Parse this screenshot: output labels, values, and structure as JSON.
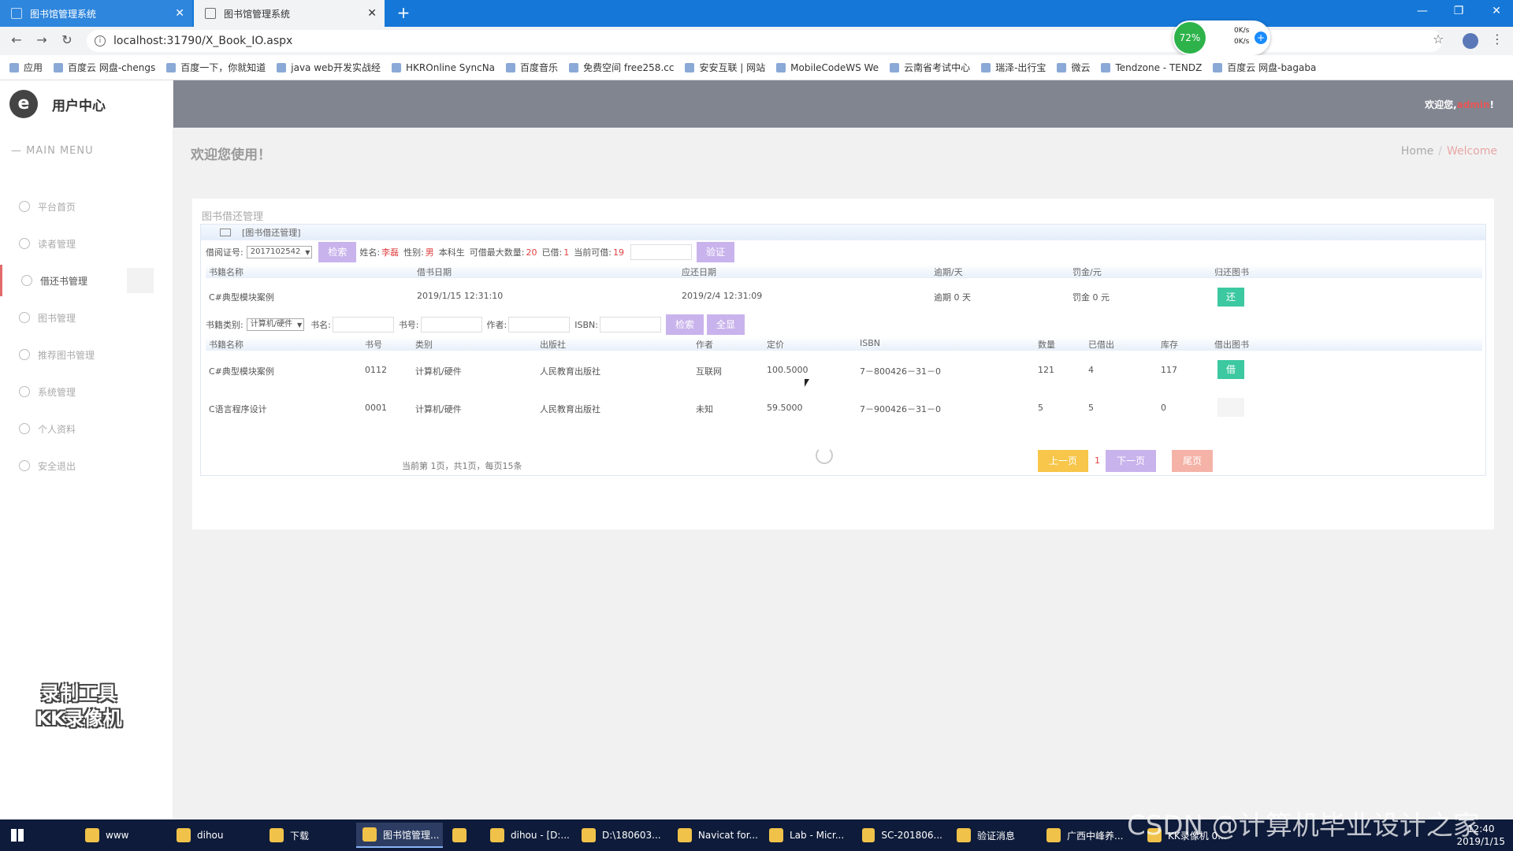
{
  "browser": {
    "tabs": [
      {
        "label": "图书馆管理系统",
        "active": false
      },
      {
        "label": "图书馆管理系统",
        "active": true
      }
    ],
    "url": "localhost:31790/X_Book_IO.aspx",
    "net_widget": {
      "percent": "72%",
      "up": "0K/s",
      "down": "0K/s"
    },
    "bookmarks": [
      "应用",
      "百度云 网盘-chengs",
      "百度一下，你就知道",
      "java web开发实战经",
      "HKROnline SyncNa",
      "百度音乐",
      "免费空间 free258.cc",
      "安安互联 | 网站",
      "MobileCodeWS We",
      "云南省考试中心",
      "瑞泽-出行宝",
      "微云",
      "Tendzone - TENDZ",
      "百度云 网盘-bagaba"
    ]
  },
  "sidebar": {
    "brand": "用户中心",
    "logo": "e",
    "menu_title": "MAIN MENU",
    "items": [
      {
        "label": "平台首页",
        "icon": "eye-icon"
      },
      {
        "label": "读者管理",
        "icon": "reader-icon"
      },
      {
        "label": "借还书管理",
        "icon": "book-borrow-icon",
        "active": true
      },
      {
        "label": "图书管理",
        "icon": "trophy-icon"
      },
      {
        "label": "推荐图书管理",
        "icon": "diamond-icon"
      },
      {
        "label": "系统管理",
        "icon": "monitor-icon"
      },
      {
        "label": "个人资料",
        "icon": "chat-icon"
      },
      {
        "label": "安全退出",
        "icon": "power-icon"
      }
    ],
    "watermark_line1": "录制工具",
    "watermark_line2": "KK录像机"
  },
  "topbar": {
    "welcome": "欢迎您,",
    "user": "admin",
    "suffix": "!"
  },
  "main": {
    "page_title": "欢迎您使用！",
    "breadcrumb": {
      "home": "Home",
      "sep": "/",
      "current": "Welcome"
    },
    "card_caption": "图书借还管理",
    "panel_title": "[图书借还管理]",
    "reader_bar": {
      "card_label": "借阅证号:",
      "card_value": "2017102542",
      "search_btn": "检索",
      "name_label": "姓名:",
      "name": "李磊",
      "gender_label": "性别:",
      "gender": "男",
      "level": "本科生",
      "max_label": "可借最大数量:",
      "max": "20",
      "borrowed_label": "已借:",
      "borrowed": "1",
      "remaining_label": "当前可借:",
      "remaining": "19",
      "verify_btn": "验证"
    },
    "borrow_table": {
      "headers": [
        "书籍名称",
        "借书日期",
        "应还日期",
        "逾期/天",
        "罚金/元",
        "归还图书"
      ],
      "rows": [
        {
          "name": "C#典型模块案例",
          "borrow_date": "2019/1/15 12:31:10",
          "due_date": "2019/2/4 12:31:09",
          "overdue": "逾期 0 天",
          "fine": "罚金 0 元",
          "action": "还"
        }
      ]
    },
    "filter_bar": {
      "category_label": "书籍类别:",
      "category": "计算机/硬件",
      "title_label": "书名:",
      "number_label": "书号:",
      "author_label": "作者:",
      "isbn_label": "ISBN:",
      "search_btn": "检索",
      "all_btn": "全显"
    },
    "book_table": {
      "headers": [
        "书籍名称",
        "书号",
        "类别",
        "出版社",
        "作者",
        "定价",
        "ISBN",
        "数量",
        "已借出",
        "库存",
        "借出图书"
      ],
      "rows": [
        {
          "name": "C#典型模块案例",
          "no": "0112",
          "cat": "计算机/硬件",
          "pub": "人民教育出版社",
          "author": "互联网",
          "price": "100.5000",
          "isbn": "7－800426－31－0",
          "qty": "121",
          "lent": "4",
          "stock": "117",
          "action": "借"
        },
        {
          "name": "C语言程序设计",
          "no": "0001",
          "cat": "计算机/硬件",
          "pub": "人民教育出版社",
          "author": "未知",
          "price": "59.5000",
          "isbn": "7－900426－31－0",
          "qty": "5",
          "lent": "5",
          "stock": "0",
          "action": ""
        }
      ]
    },
    "pager": {
      "info": "当前第 1页，共1页，每页15条",
      "prev": "上一页",
      "page": "1",
      "next": "下一页",
      "last": "尾页"
    }
  },
  "taskbar": {
    "tasks": [
      "www",
      "dihou",
      "下载",
      "图书馆管理...",
      "",
      "dihou - [D:...",
      "D:\\180603...",
      "Navicat for...",
      "Lab - Micr...",
      "SC-201806...",
      "验证消息",
      "广西中峰养...",
      "KK录像机 0..."
    ],
    "time": "12:40",
    "date": "2019/1/15",
    "watermark": "CSDN @计算机毕业设计之家"
  }
}
